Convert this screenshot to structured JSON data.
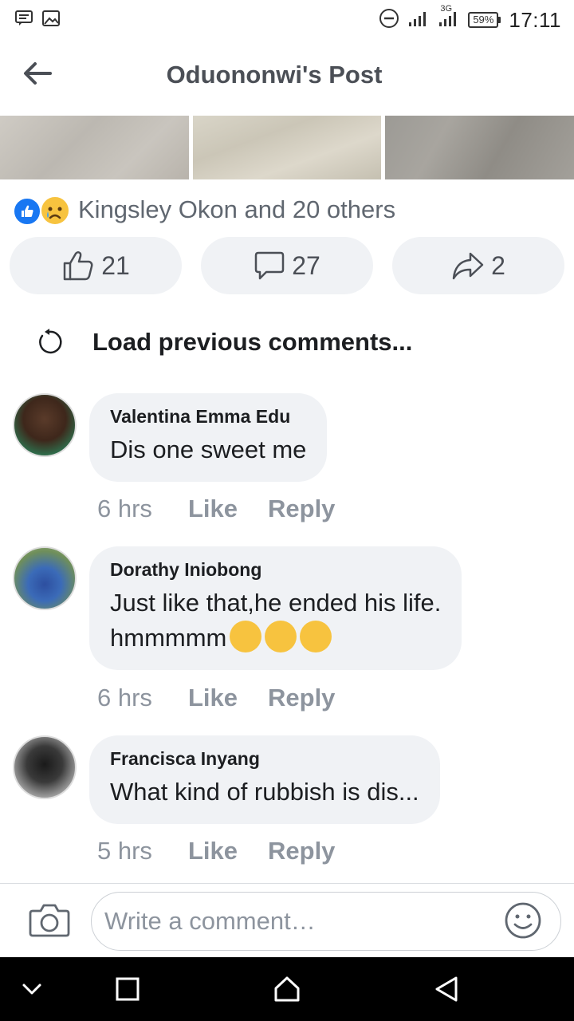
{
  "status_bar": {
    "time": "17:11",
    "battery": "59%",
    "network": "3G"
  },
  "header": {
    "title": "Oduononwi's Post"
  },
  "reactions": {
    "summary": "Kingsley Okon and 20 others"
  },
  "actions": {
    "like_count": "21",
    "comment_count": "27",
    "share_count": "2"
  },
  "load_previous": "Load previous comments...",
  "comments": [
    {
      "name": "Valentina Emma Edu",
      "text": "Dis one sweet me",
      "time": "6 hrs",
      "like": "Like",
      "reply": "Reply"
    },
    {
      "name": "Dorathy Iniobong",
      "text_line1": "Just like that,he ended his life.",
      "text_line2": "hmmmmm",
      "emojis": [
        "thinking-face",
        "thinking-face",
        "thinking-face"
      ],
      "time": "6 hrs",
      "like": "Like",
      "reply": "Reply"
    },
    {
      "name": "Francisca Inyang",
      "text": "What kind of rubbish is dis...",
      "time": "5 hrs",
      "like": "Like",
      "reply": "Reply"
    }
  ],
  "composer": {
    "placeholder": "Write a comment…"
  },
  "colors": {
    "accent": "#1877f2",
    "pill_bg": "#f0f2f5",
    "muted_text": "#8d949e"
  }
}
